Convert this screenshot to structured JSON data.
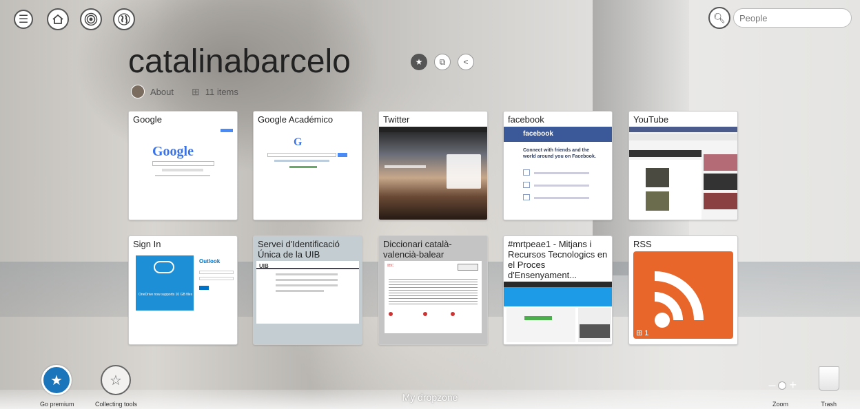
{
  "topbar": {
    "menu_icon": "menu-icon",
    "home_icon": "home-icon",
    "activity_icon": "podcast-icon",
    "globe_icon": "globe-icon",
    "search_placeholder": "People"
  },
  "profile": {
    "username": "catalinabarcelo",
    "about_label": "About",
    "items_label": "11 items"
  },
  "cards": [
    {
      "title": "Google"
    },
    {
      "title": "Google Académico"
    },
    {
      "title": "Twitter"
    },
    {
      "title": "facebook"
    },
    {
      "title": "YouTube"
    },
    {
      "title": "Sign In"
    },
    {
      "title": "Servei d'Identificació Única de la UIB"
    },
    {
      "title": "Diccionari català-valencià-balear"
    },
    {
      "title": "#mrtpeae1 - Mitjans i Recursos Tecnologics en el Proces d'Ensenyament..."
    },
    {
      "title": "RSS",
      "count": "1"
    }
  ],
  "thumbs": {
    "google_logo": "Google",
    "facebook_header": "facebook",
    "facebook_tagline": "Connect with friends and the world around you on Facebook.",
    "outlook_label": "Outlook",
    "onedrive_text": "OneDrive now supports 10 GB files"
  },
  "bottom": {
    "go_premium": "Go premium",
    "collecting_tools": "Collecting tools",
    "dropzone": "My dropzone",
    "zoom": "Zoom",
    "trash": "Trash"
  },
  "colors": {
    "rss_orange": "#e8662a",
    "facebook_blue": "#3b5998",
    "premium_blue": "#1b75bb"
  }
}
